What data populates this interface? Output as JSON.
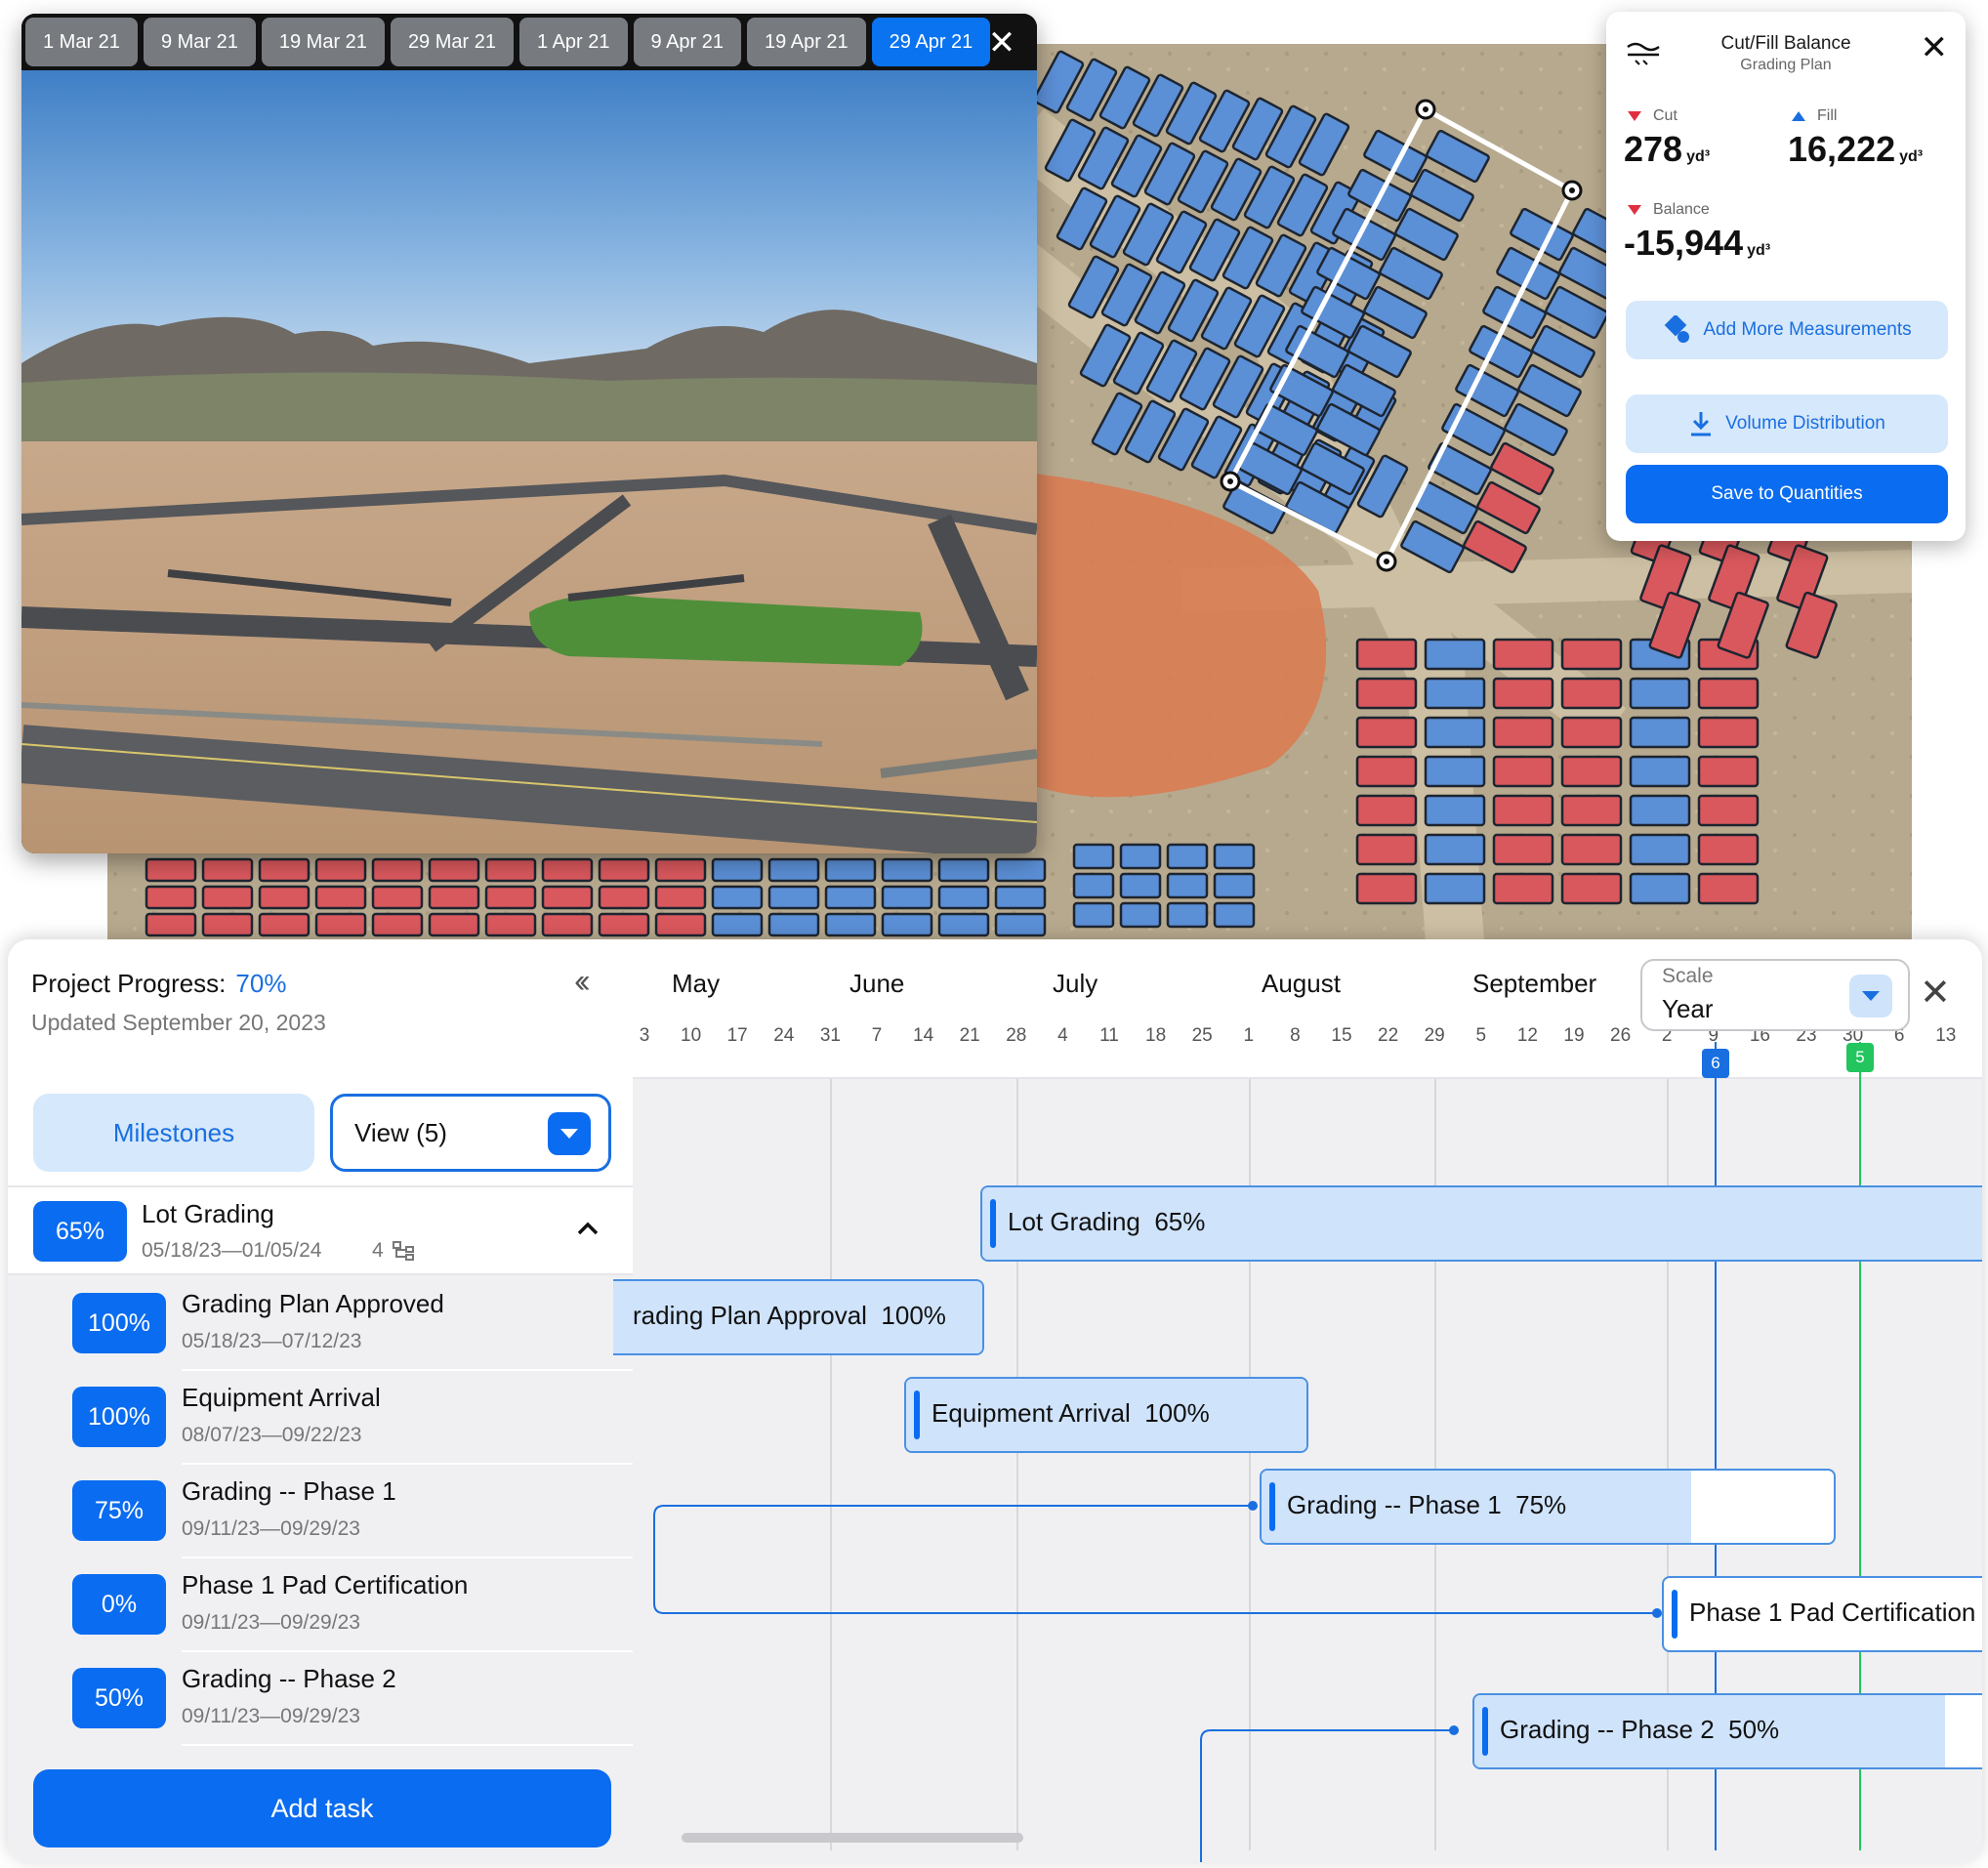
{
  "photo_viewer": {
    "dates": [
      "1 Mar 21",
      "9 Mar 21",
      "19 Mar 21",
      "29 Mar 21",
      "1 Apr 21",
      "9 Apr 21",
      "19 Apr 21",
      "29 Apr 21"
    ],
    "active_date": "29 Apr 21",
    "close_icon": "close-icon"
  },
  "cutfill": {
    "title": "Cut/Fill Balance",
    "subtitle": "Grading Plan",
    "cut_label": "Cut",
    "cut_value": "278",
    "fill_label": "Fill",
    "fill_value": "16,222",
    "balance_label": "Balance",
    "balance_value": "-15,944",
    "unit": "yd³",
    "add_measurements_label": "Add More Measurements",
    "volume_distribution_label": "Volume Distribution",
    "save_label": "Save to Quantities"
  },
  "project": {
    "progress_label": "Project Progress:",
    "progress_value": "70%",
    "updated": "Updated September 20, 2023",
    "milestones_label": "Milestones",
    "view_label": "View (5)",
    "add_task_label": "Add task"
  },
  "parent_task": {
    "percent": "65%",
    "title": "Lot Grading",
    "dates": "05/18/23—01/05/24",
    "subtask_count": "4"
  },
  "tasks": [
    {
      "percent": "100%",
      "title": "Grading Plan Approved",
      "dates": "05/18/23—07/12/23"
    },
    {
      "percent": "100%",
      "title": "Equipment Arrival",
      "dates": "08/07/23—09/22/23"
    },
    {
      "percent": "75%",
      "title": "Grading -- Phase 1",
      "dates": "09/11/23—09/29/23"
    },
    {
      "percent": "0%",
      "title": "Phase 1 Pad Certification",
      "dates": "09/11/23—09/29/23"
    },
    {
      "percent": "50%",
      "title": "Grading -- Phase 2",
      "dates": "09/11/23—09/29/23"
    }
  ],
  "gantt": {
    "months": [
      "May",
      "June",
      "July",
      "August",
      "September"
    ],
    "days": [
      "3",
      "10",
      "17",
      "24",
      "31",
      "7",
      "14",
      "21",
      "28",
      "4",
      "11",
      "18",
      "25",
      "1",
      "8",
      "15",
      "22",
      "29",
      "5",
      "12",
      "19",
      "26",
      "2",
      "9",
      "16",
      "23",
      "30",
      "6",
      "13"
    ],
    "scale_label": "Scale",
    "scale_value": "Year",
    "marker_blue": "6",
    "marker_green": "5",
    "colors": {
      "accent": "#0a6cf0",
      "marker_green": "#22c55e",
      "bar_fill": "#cfe3fb",
      "cut": "#e03040"
    },
    "bars": [
      {
        "label": "Lot Grading",
        "percent": "65%",
        "progress": 1.0
      },
      {
        "label": "rading Plan Approval",
        "percent": "100%",
        "progress": 1.0
      },
      {
        "label": "Equipment Arrival",
        "percent": "100%",
        "progress": 1.0
      },
      {
        "label": "Grading -- Phase 1",
        "percent": "75%",
        "progress": 0.75
      },
      {
        "label": "Phase 1 Pad Certification",
        "percent": "",
        "progress": 0
      },
      {
        "label": "Grading -- Phase 2",
        "percent": "50%",
        "progress": 0.9
      }
    ]
  }
}
